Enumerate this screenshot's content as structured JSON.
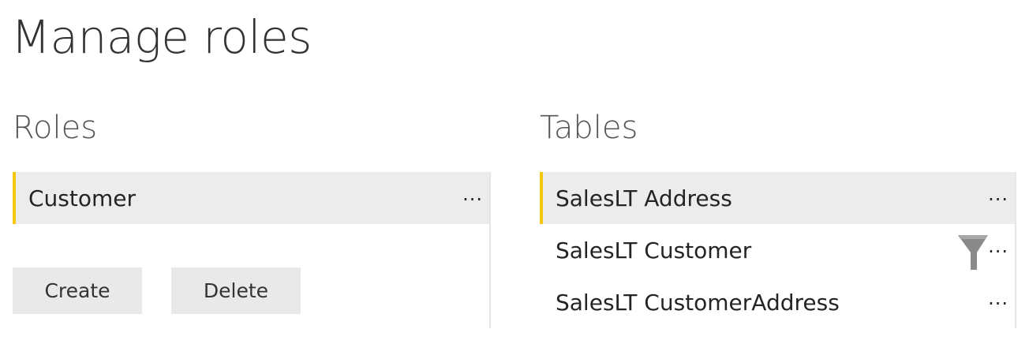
{
  "header": {
    "title": "Manage roles"
  },
  "roles": {
    "title": "Roles",
    "items": [
      {
        "label": "Customer",
        "selected": true,
        "menu": "..."
      }
    ],
    "create_label": "Create",
    "delete_label": "Delete"
  },
  "tables": {
    "title": "Tables",
    "items": [
      {
        "label": "SalesLT Address",
        "selected": true,
        "menu": "...",
        "has_filter": false
      },
      {
        "label": "SalesLT Customer",
        "selected": false,
        "menu": "...",
        "has_filter": true
      },
      {
        "label": "SalesLT CustomerAddress",
        "selected": false,
        "menu": "...",
        "has_filter": false
      }
    ]
  },
  "icons": {
    "filter": "filter-funnel-icon",
    "more": "ellipsis-icon"
  },
  "colors": {
    "accent": "#f2c811",
    "selected_bg": "#ececec",
    "button_bg": "#e9e9e9"
  }
}
